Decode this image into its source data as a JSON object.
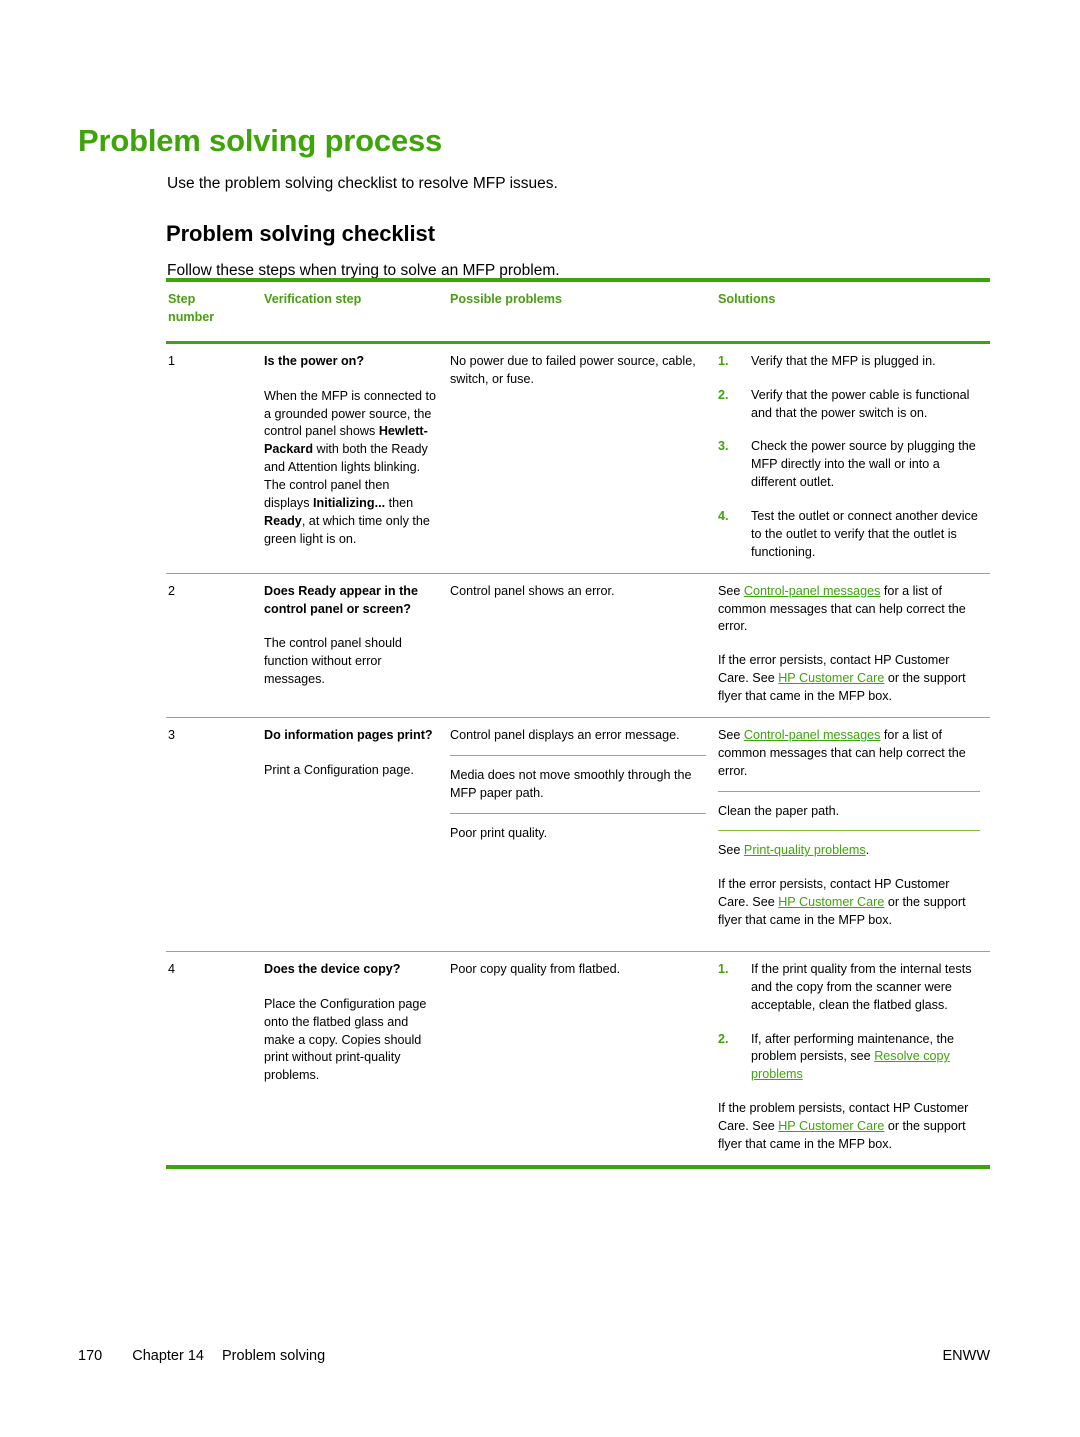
{
  "page": {
    "title": "Problem solving process",
    "intro": "Use the problem solving checklist to resolve MFP issues.",
    "subheading": "Problem solving checklist",
    "lead": "Follow these steps when trying to solve an MFP problem.",
    "accent_color": "#3DA50A",
    "header_text_color": "#4A9E10",
    "rule_color": "#7FBF3F"
  },
  "table": {
    "headers": {
      "step_line1": "Step",
      "step_line2": "number",
      "verification": "Verification step",
      "problems": "Possible problems",
      "solutions": "Solutions"
    },
    "rows": [
      {
        "number": "1",
        "question": "Is the power on?",
        "description_parts": [
          {
            "text": "When the MFP is connected to a grounded power source, the control panel shows ",
            "bold": false
          },
          {
            "text": "Hewlett-Packard",
            "bold": true
          },
          {
            "text": " with both the Ready and Attention lights blinking. The control panel then displays ",
            "bold": false
          },
          {
            "text": "Initializing...",
            "bold": true
          },
          {
            "text": " then ",
            "bold": false
          },
          {
            "text": "Ready",
            "bold": true
          },
          {
            "text": ", at which time only the green light is on.",
            "bold": false
          }
        ],
        "problem": "No power due to failed power source, cable, switch, or fuse.",
        "solution_list": [
          {
            "marker": "1.",
            "text": "Verify that the MFP is plugged in."
          },
          {
            "marker": "2.",
            "text": "Verify that the power cable is functional and that the power switch is on."
          },
          {
            "marker": "3.",
            "text": "Check the power source by plugging the MFP directly into the wall or into a different outlet."
          },
          {
            "marker": "4.",
            "text": "Test the outlet or connect another device to the outlet to verify that the outlet is functioning."
          }
        ]
      },
      {
        "number": "2",
        "question": "Does Ready appear in the control panel or screen?",
        "description": "The control panel should function without error messages.",
        "problem": "Control panel shows an error.",
        "solution_paras": [
          {
            "pre": "See ",
            "link": "Control-panel messages",
            "post": " for a list of common messages that can help correct the error."
          },
          {
            "pre": "If the error persists, contact HP Customer Care. See ",
            "link": "HP Customer Care",
            "post": " or the support flyer that came in the MFP box."
          }
        ]
      },
      {
        "number": "3",
        "question": "Do information pages print?",
        "description": "Print a Configuration page.",
        "subrows": [
          {
            "problem": "Control panel displays an error message.",
            "solution_paras": [
              {
                "pre": "See ",
                "link": "Control-panel messages",
                "post": " for a list of common messages that can help correct the error."
              }
            ]
          },
          {
            "problem": "Media does not move smoothly through the MFP paper path.",
            "solution_paras": [
              {
                "pre": "Clean the paper path.",
                "link": "",
                "post": ""
              }
            ]
          },
          {
            "problem": "Poor print quality.",
            "solution_paras": [
              {
                "pre": "See ",
                "link": "Print-quality problems",
                "post": "."
              },
              {
                "pre": "If the error persists, contact HP Customer Care. See ",
                "link": "HP Customer Care",
                "post": " or the support flyer that came in the MFP box."
              }
            ]
          }
        ]
      },
      {
        "number": "4",
        "question": "Does the device copy?",
        "description": "Place the Configuration page onto the flatbed glass and make a copy. Copies should print without print-quality problems.",
        "problem": "Poor copy quality from flatbed.",
        "solution_list": [
          {
            "marker": "1.",
            "text": "If the print quality from the internal tests and the copy from the scanner were acceptable, clean the flatbed glass."
          },
          {
            "marker": "2.",
            "pre": "If, after performing maintenance, the problem persists, see ",
            "link": "Resolve copy problems",
            "post": ""
          }
        ],
        "solution_trailing": {
          "pre": "If the problem persists, contact HP Customer Care. See ",
          "link": "HP Customer Care",
          "post": " or the support flyer that came in the MFP box."
        }
      }
    ]
  },
  "footer": {
    "page_number": "170",
    "chapter": "Chapter 14",
    "chapter_title": "Problem solving",
    "locale": "ENWW"
  }
}
